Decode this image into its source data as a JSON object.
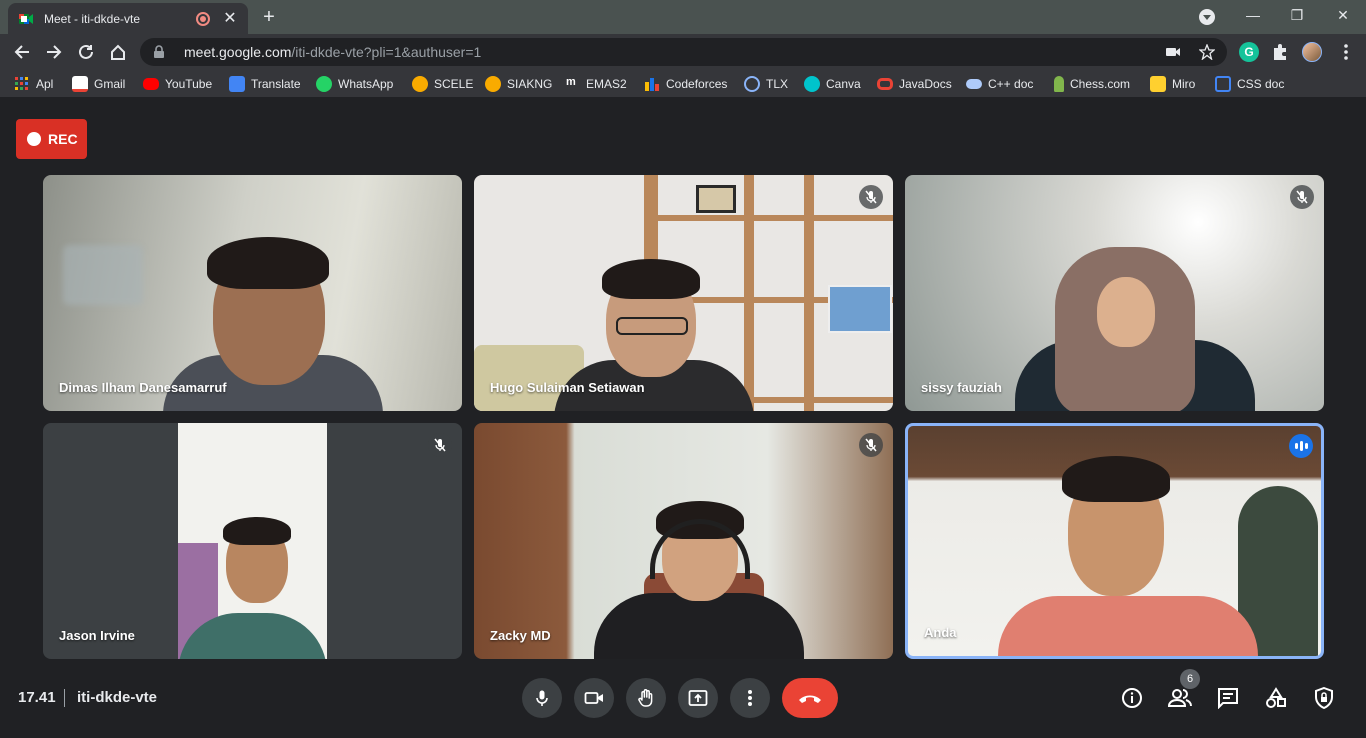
{
  "browser": {
    "tab_title": "Meet - iti-dkde-vte",
    "url_host": "meet.google.com",
    "url_path": "/iti-dkde-vte?pli=1&authuser=1"
  },
  "bookmarks": [
    {
      "label": "Apl",
      "color": "#ea4335"
    },
    {
      "label": "Gmail",
      "color": "#ea4335"
    },
    {
      "label": "YouTube",
      "color": "#ff0000"
    },
    {
      "label": "Translate",
      "color": "#4285f4"
    },
    {
      "label": "WhatsApp",
      "color": "#25d366"
    },
    {
      "label": "SCELE",
      "color": "#f9ab00"
    },
    {
      "label": "SIAKNG",
      "color": "#f9ab00"
    },
    {
      "label": "EMAS2",
      "color": "#ffffff"
    },
    {
      "label": "Codeforces",
      "color": "#1a73e8"
    },
    {
      "label": "TLX",
      "color": "#8ab4f8"
    },
    {
      "label": "Canva",
      "color": "#00c4cc"
    },
    {
      "label": "JavaDocs",
      "color": "#ea4335"
    },
    {
      "label": "C++ doc",
      "color": "#aecbfa"
    },
    {
      "label": "Chess.com",
      "color": "#81b64c"
    },
    {
      "label": "Miro",
      "color": "#ffd02f"
    },
    {
      "label": "CSS  doc",
      "color": "#4285f4"
    }
  ],
  "meeting": {
    "rec_label": "REC",
    "time": "17.41",
    "code": "iti-dkde-vte",
    "participant_count": "6"
  },
  "participants": [
    {
      "name": "Dimas Ilham Danesamarruf",
      "muted": false
    },
    {
      "name": "Hugo Sulaiman Setiawan",
      "muted": true
    },
    {
      "name": "sissy fauziah",
      "muted": true
    },
    {
      "name": "Jason Irvine",
      "muted": true
    },
    {
      "name": "Zacky MD",
      "muted": true
    },
    {
      "name": "Anda",
      "muted": false,
      "speaking": true
    }
  ],
  "colors": {
    "end_call": "#ea4335",
    "rec": "#d93025",
    "active_border": "#8ab4f8"
  }
}
